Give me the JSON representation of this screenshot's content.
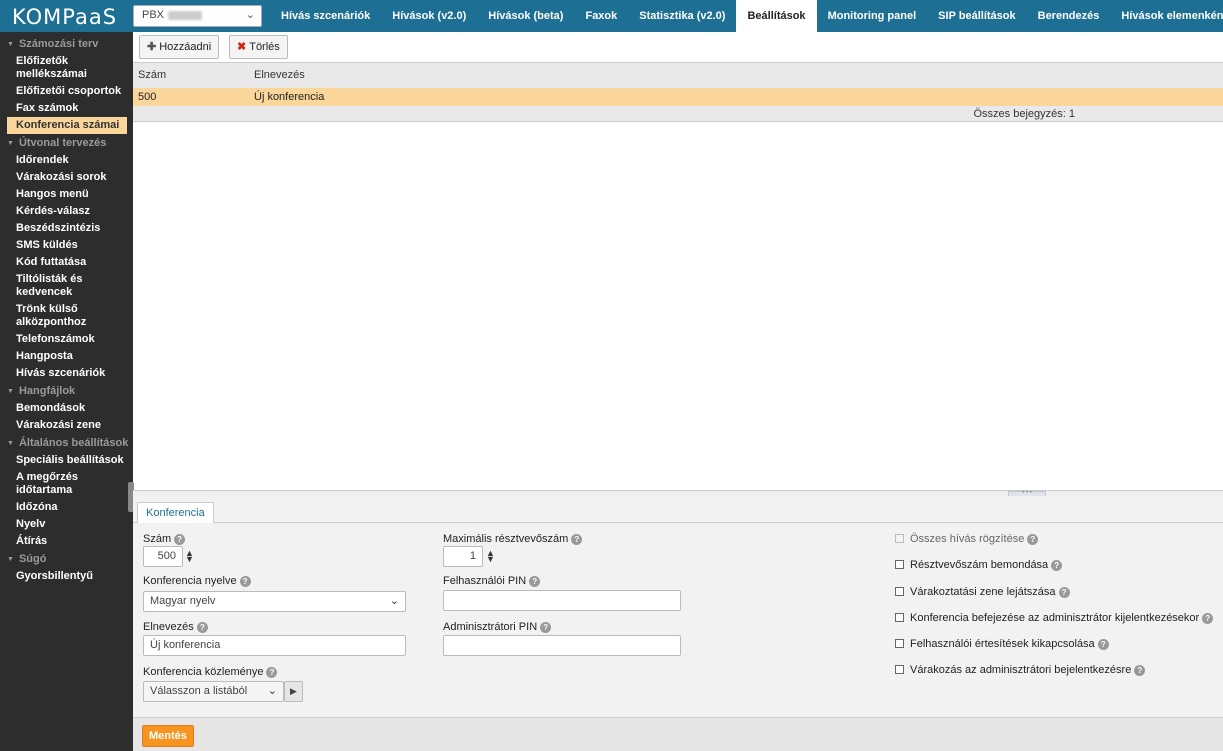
{
  "app": {
    "logo": "KOMPaaS"
  },
  "pbx": {
    "label": "PBX"
  },
  "nav": {
    "tabs": [
      "Hívás szcenáriók",
      "Hívások (v2.0)",
      "Hívások (beta)",
      "Faxok",
      "Statisztika (v2.0)",
      "Beállítások",
      "Monitoring panel",
      "SIP beállítások",
      "Berendezés",
      "Hívások elemenként"
    ],
    "active": "Beállítások"
  },
  "sidebar": {
    "groups": [
      {
        "label": "Számozási terv",
        "items": [
          "Előfizetők mellékszámai",
          "Előfizetői csoportok",
          "Fax számok",
          "Konferencia számai"
        ]
      },
      {
        "label": "Útvonal tervezés",
        "items": [
          "Időrendek",
          "Várakozási sorok",
          "Hangos menü",
          "Kérdés-válasz",
          "Beszédszintézis",
          "SMS küldés",
          "Kód futtatása",
          "Tiltólisták és kedvencek",
          "Trönk külső alközponthoz",
          "Telefonszámok",
          "Hangposta",
          "Hívás szcenáriók"
        ]
      },
      {
        "label": "Hangfájlok",
        "items": [
          "Bemondások",
          "Várakozási zene"
        ]
      },
      {
        "label": "Általános beállítások",
        "items": [
          "Speciális beállítások",
          "A megőrzés időtartama",
          "Időzóna",
          "Nyelv",
          "Átírás"
        ]
      },
      {
        "label": "Súgó",
        "items": [
          "Gyorsbillentyű"
        ]
      }
    ],
    "active_item": "Konferencia számai"
  },
  "toolbar": {
    "add_label": "Hozzáadni",
    "delete_label": "Törlés"
  },
  "grid": {
    "columns": [
      "Szám",
      "Elnevezés"
    ],
    "rows": [
      [
        "500",
        "Új konferencia"
      ]
    ],
    "total": "Összes bejegyzés: 1"
  },
  "detail": {
    "tab": "Konferencia",
    "fields": {
      "szam_label": "Szám",
      "szam_value": "500",
      "nyelv_label": "Konferencia nyelve",
      "nyelv_value": "Magyar nyelv",
      "elnevezes_label": "Elnevezés",
      "elnevezes_value": "Új konferencia",
      "kozlemeny_label": "Konferencia közleménye",
      "kozlemeny_placeholder": "Válasszon a listából",
      "max_label": "Maximális résztvevőszám",
      "max_value": "1",
      "user_pin_label": "Felhasználói PIN",
      "user_pin_value": "",
      "admin_pin_label": "Adminisztrátori PIN",
      "admin_pin_value": ""
    },
    "checkboxes": [
      "Összes hívás rögzítése",
      "Résztvevőszám bemondása",
      "Várakoztatási zene lejátszása",
      "Konferencia befejezése az adminisztrátor kijelentkezésekor",
      "Felhasználói értesítések kikapcsolása",
      "Várakozás az adminisztrátori bejelentkezésre"
    ],
    "save_label": "Mentés"
  }
}
